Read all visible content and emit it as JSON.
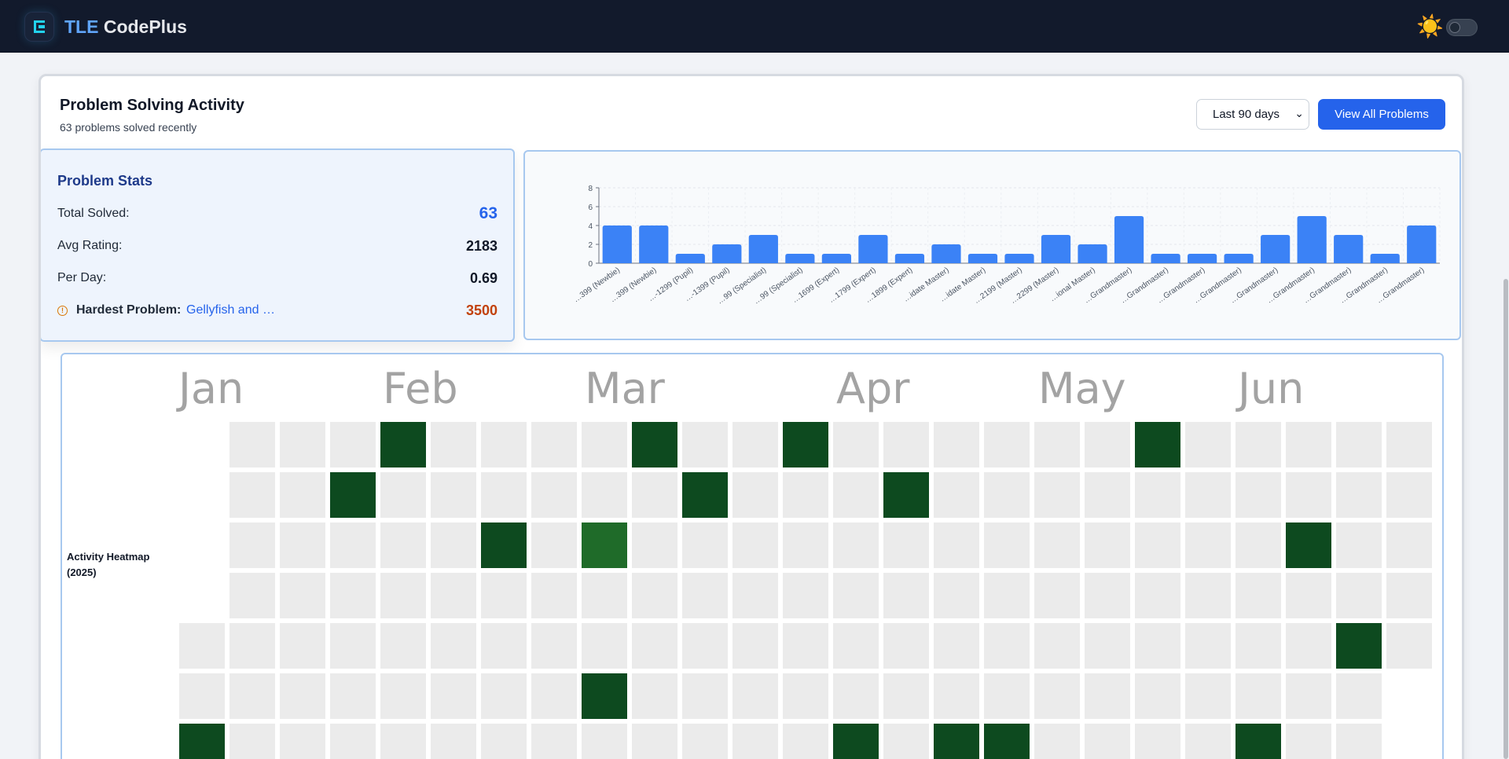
{
  "header": {
    "brand_prefix": "TLE",
    "brand_suffix": " CodePlus",
    "theme_icon": "sun-icon",
    "theme_toggle_on": false
  },
  "activity": {
    "title": "Problem Solving Activity",
    "subtitle": "63 problems solved recently",
    "range_select": {
      "selected": "Last 90 days"
    },
    "view_all_label": "View All Problems"
  },
  "stats": {
    "title": "Problem Stats",
    "total_solved_label": "Total Solved:",
    "total_solved": "63",
    "avg_rating_label": "Avg Rating:",
    "avg_rating": "2183",
    "per_day_label": "Per Day:",
    "per_day": "0.69",
    "hardest_label": "Hardest Problem:",
    "hardest_name": "Gellyfish and …",
    "hardest_rating": "3500"
  },
  "chart_data": {
    "type": "bar",
    "categories": [
      "…399 (Newbie)",
      "…399 (Newbie)",
      "…-1299 (Pupil)",
      "…-1399 (Pupil)",
      "…99 (Specialist)",
      "…99 (Specialist)",
      "…1699 (Expert)",
      "…1799 (Expert)",
      "…1899 (Expert)",
      "…idate Master)",
      "…idate Master)",
      "…2199 (Master)",
      "…2299 (Master)",
      "…ional Master)",
      "…Grandmaster)",
      "…Grandmaster)",
      "…Grandmaster)",
      "…Grandmaster)",
      "…Grandmaster)",
      "…Grandmaster)",
      "…Grandmaster)",
      "…Grandmaster)",
      "…Grandmaster)"
    ],
    "values": [
      4,
      4,
      1,
      2,
      3,
      1,
      1,
      3,
      1,
      2,
      1,
      1,
      3,
      2,
      5,
      1,
      1,
      1,
      3,
      5,
      3,
      1,
      4
    ],
    "yticks": [
      0,
      2,
      4,
      6,
      8
    ],
    "ylim": [
      0,
      8
    ],
    "grid": true,
    "bar_color": "#3b82f6"
  },
  "heatmap": {
    "label": "Activity Heatmap (2025)",
    "months": [
      "Jan",
      "Feb",
      "Mar",
      "Apr",
      "May",
      "Jun"
    ],
    "empty_color": "#ebebeb",
    "active_color": "#0d4a1f",
    "medium_color": "#1f6b29",
    "first_col_start_row": 4,
    "last_col_end_row": 4,
    "active": [
      {
        "col": 4,
        "row": 0,
        "level": 4
      },
      {
        "col": 9,
        "row": 0,
        "level": 4
      },
      {
        "col": 12,
        "row": 0,
        "level": 4
      },
      {
        "col": 19,
        "row": 0,
        "level": 4
      },
      {
        "col": 3,
        "row": 1,
        "level": 4
      },
      {
        "col": 10,
        "row": 1,
        "level": 4
      },
      {
        "col": 14,
        "row": 1,
        "level": 4
      },
      {
        "col": 6,
        "row": 2,
        "level": 4
      },
      {
        "col": 8,
        "row": 2,
        "level": 3
      },
      {
        "col": 22,
        "row": 2,
        "level": 4
      },
      {
        "col": 23,
        "row": 4,
        "level": 4
      },
      {
        "col": 8,
        "row": 5,
        "level": 4
      },
      {
        "col": 0,
        "row": 6,
        "level": 4
      },
      {
        "col": 13,
        "row": 6,
        "level": 4
      },
      {
        "col": 15,
        "row": 6,
        "level": 4
      },
      {
        "col": 16,
        "row": 6,
        "level": 4
      },
      {
        "col": 21,
        "row": 6,
        "level": 4
      }
    ]
  }
}
